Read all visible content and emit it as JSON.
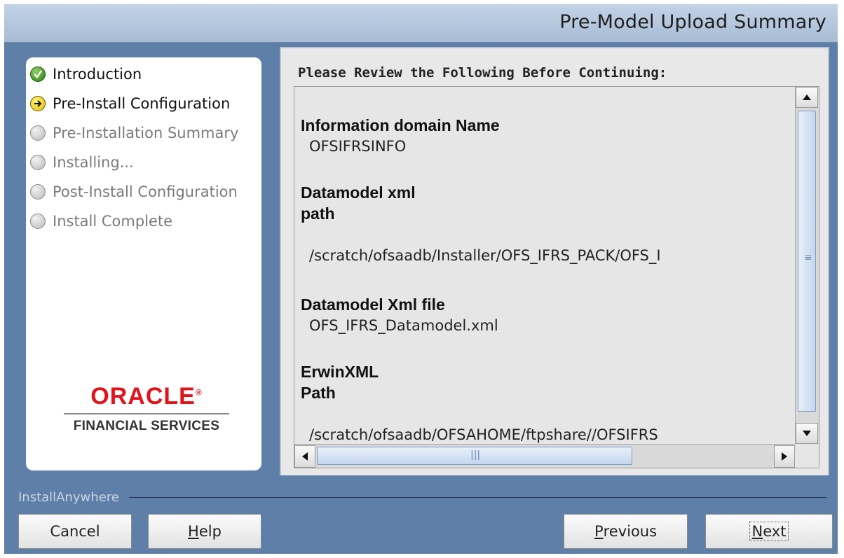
{
  "window": {
    "title": "Pre-Model Upload Summary"
  },
  "steps": [
    {
      "label": "Introduction",
      "state": "done",
      "icon": "checkmark-icon"
    },
    {
      "label": "Pre-Install Configuration",
      "state": "current",
      "icon": "arrow-right-icon"
    },
    {
      "label": "Pre-Installation Summary",
      "state": "pending",
      "icon": "circle-icon"
    },
    {
      "label": "Installing...",
      "state": "pending",
      "icon": "circle-icon"
    },
    {
      "label": "Post-Install Configuration",
      "state": "pending",
      "icon": "circle-icon"
    },
    {
      "label": "Install Complete",
      "state": "pending",
      "icon": "circle-icon"
    }
  ],
  "logo": {
    "word": "ORACLE",
    "mark": "®",
    "subtitle": "FINANCIAL SERVICES"
  },
  "summary": {
    "heading": "Please Review the Following Before Continuing:",
    "fields": [
      {
        "label_lines": [
          "Information domain Name"
        ],
        "value": "OFSIFRSINFO"
      },
      {
        "label_lines": [
          "Datamodel xml",
          "path"
        ],
        "value": "/scratch/ofsaadb/Installer/OFS_IFRS_PACK/OFS_I"
      },
      {
        "label_lines": [
          "Datamodel Xml file"
        ],
        "value": "OFS_IFRS_Datamodel.xml"
      },
      {
        "label_lines": [
          "ErwinXML",
          "Path"
        ],
        "value": "/scratch/ofsaadb/OFSAHOME/ftpshare//OFSIFRS"
      }
    ]
  },
  "footer": {
    "brand": "InstallAnywhere",
    "buttons": {
      "cancel": "Cancel",
      "help_mnemonic": "H",
      "help_rest": "elp",
      "previous_mnemonic": "P",
      "previous_rest": "revious",
      "next_mnemonic": "N",
      "next_rest": "ext"
    }
  },
  "colors": {
    "frame": "#5d7fa8",
    "oracle_red": "#e0141a",
    "scroll_thumb": "#c4d6ee"
  }
}
